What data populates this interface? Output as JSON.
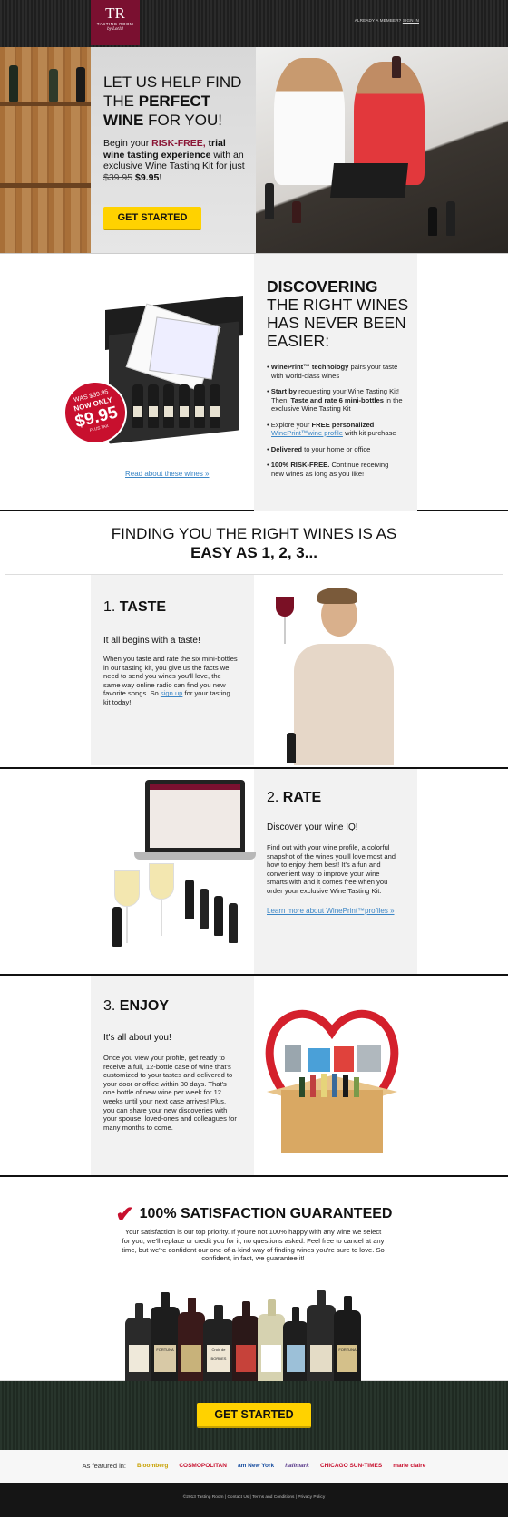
{
  "header": {
    "logo_mono": "TR",
    "logo_name": "TASTING ROOM",
    "logo_by": "by Lot18",
    "member_text": "ALREADY A MEMBER?",
    "signin": "SIGN IN"
  },
  "hero": {
    "title_pre": "LET US HELP FIND THE ",
    "title_bold": "PERFECT WINE",
    "title_post": " FOR YOU!",
    "sub_1": "Begin your ",
    "sub_risk": "RISK-FREE,",
    "sub_2": " trial ",
    "sub_bold": "wine tasting experience",
    "sub_3": " with an exclusive Wine Tasting Kit for just ",
    "old_price": "$39.95",
    "new_price": "$9.95!",
    "cta": "GET STARTED"
  },
  "discover": {
    "h_bold": "DISCOVERING",
    "h_rest": "THE RIGHT WINES HAS NEVER BEEN EASIER:",
    "badge_was": "WAS $39.95",
    "badge_now": "NOW ONLY",
    "badge_price": "$9.95",
    "badge_tax": "PLUS TAX",
    "read_link": "Read about these wines »",
    "bullets": [
      {
        "bold": "WinePrint™ technology",
        "text": " pairs your taste with world-class wines"
      },
      {
        "bold": "Start by",
        "text": " requesting your Wine Tasting Kit! Then, ",
        "bold2": "Taste and rate 6 mini-bottles",
        "text2": " in the exclusive Wine Tasting Kit"
      },
      {
        "text": "Explore your ",
        "bold": "FREE personalized",
        "link": "WinePrint™wine profile",
        "text2": " with kit purchase"
      },
      {
        "bold": "Delivered",
        "text": " to your home or office"
      },
      {
        "bold": "100% RISK-FREE.",
        "text": " Continue receiving new wines as long as you like!"
      }
    ]
  },
  "easy": {
    "line1": "FINDING YOU THE RIGHT WINES IS AS",
    "line2": "EASY AS 1, 2, 3..."
  },
  "steps": {
    "taste": {
      "num": "1.",
      "title": "TASTE",
      "lead": "It all begins with a taste!",
      "body": "When you taste and rate the six mini-bottles in our tasting kit, you give us the facts we need to send you wines you'll love, the same way online radio can find you new favorite songs. So ",
      "link": "sign up",
      "body_end": " for your tasting kit today!"
    },
    "rate": {
      "num": "2.",
      "title": "RATE",
      "lead": "Discover your wine IQ!",
      "body": "Find out with your wine profile, a colorful snapshot of the wines you'll love most and how to enjoy them best! It's a fun and convenient way to improve your wine smarts with and it comes free when you order your exclusive Wine Tasting Kit.",
      "link": "Learn more about WinePrint™profiles »"
    },
    "enjoy": {
      "num": "3.",
      "title": "ENJOY",
      "lead": "It's all about you!",
      "body": "Once you view your profile, get ready to receive a full, 12-bottle case of wine that's customized to your tastes and delivered to your door or office within 30 days. That's one bottle of new wine per week for 12 weeks until your next case arrives! Plus, you can share your new discoveries with your spouse, loved-ones and colleagues for many months to come."
    }
  },
  "satisfaction": {
    "check": "✔",
    "title": "100% SATISFACTION GUARANTEED",
    "body": "Your satisfaction is our top priority. If you're not 100% happy with any wine we select for you, we'll replace or credit you for it, no questions asked. Feel free to cancel at any time, but we're confident our one-of-a-kind way of finding wines you're sure to love. So confident, in fact, we guarantee it!",
    "labels": [
      "FORTUNA",
      "Croix de BORDES",
      "FORTUNA"
    ]
  },
  "cta_bottom": "GET STARTED",
  "featured": {
    "label": "As featured in:",
    "pubs": [
      "Bloomberg",
      "COSMOPOLITAN",
      "am New York",
      "hallmark",
      "CHICAGO SUN-TIMES",
      "marie claire"
    ]
  },
  "footer": {
    "copy": "©2013 Tasting Room",
    "links": [
      "Contact Us",
      "Terms and Conditions",
      "Privacy Policy"
    ]
  },
  "colors": {
    "brand": "#7a1030",
    "accent_red": "#c8102e",
    "cta_yellow": "#ffd200",
    "link": "#3b86c6"
  }
}
